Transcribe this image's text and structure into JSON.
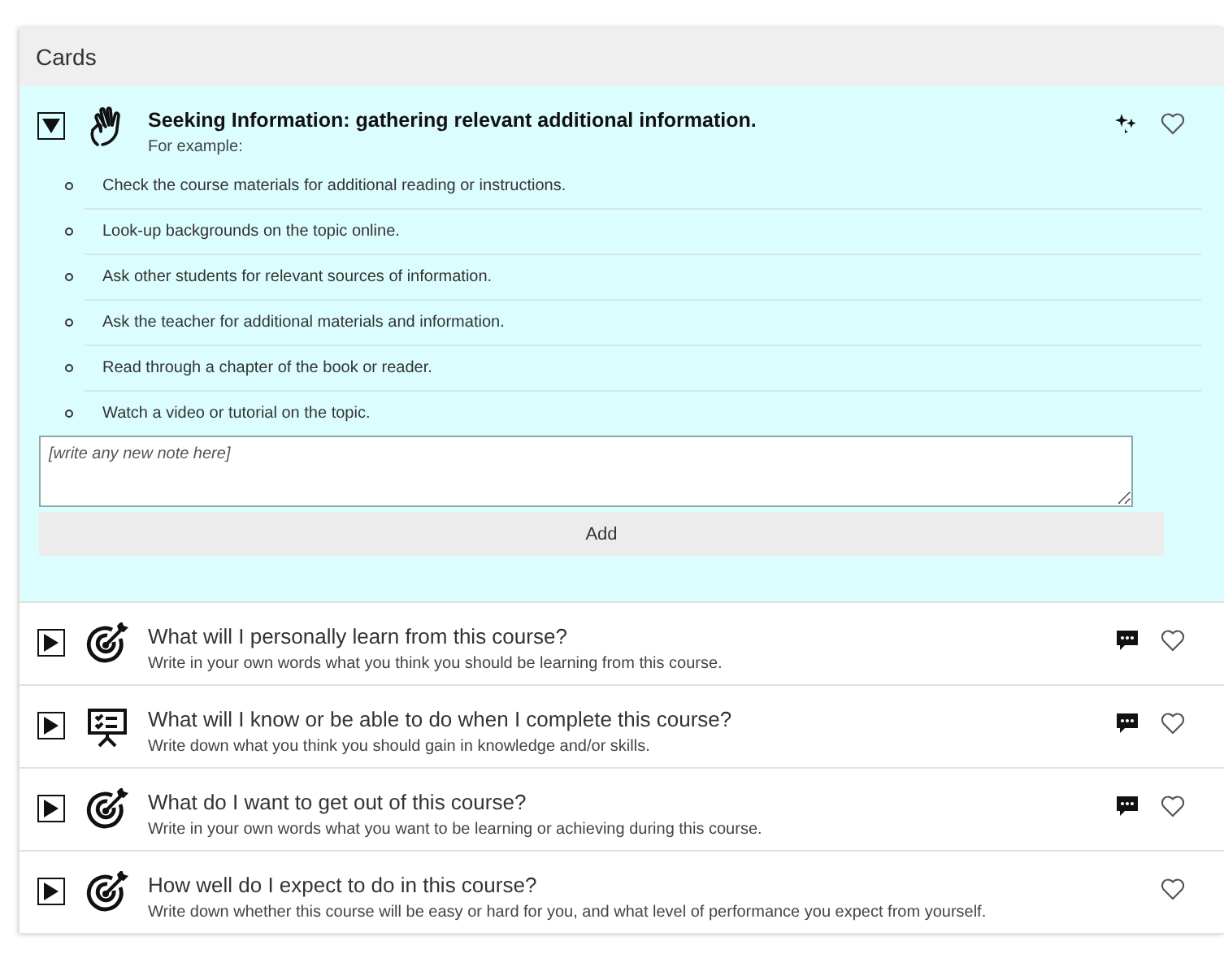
{
  "panel": {
    "title": "Cards"
  },
  "cards": [
    {
      "expanded": true,
      "icon": {
        "kind": "hand"
      },
      "badge": {
        "kind": "sparkle"
      },
      "title": "Seeking Information: gathering relevant additional information.",
      "subtitle": "For example:",
      "items": [
        "Check the course materials for additional reading or instructions.",
        "Look-up backgrounds on the topic online.",
        "Ask other students for relevant sources of information.",
        "Ask the teacher for additional materials and information.",
        "Read through a chapter of the book or reader.",
        "Watch a video or tutorial on the topic."
      ],
      "note": {
        "placeholder": "[write any new note here]"
      },
      "add_button": "Add"
    },
    {
      "expanded": false,
      "icon": {
        "kind": "target"
      },
      "badge": {
        "kind": "comment"
      },
      "title": "What will I personally learn from this course?",
      "subtitle": "Write in your own words what you think you should be learning from this course."
    },
    {
      "expanded": false,
      "icon": {
        "kind": "board"
      },
      "badge": {
        "kind": "comment"
      },
      "title": "What will I know or be able to do when I complete this course?",
      "subtitle": "Write down what you think you should gain in knowledge and/or skills."
    },
    {
      "expanded": false,
      "icon": {
        "kind": "target"
      },
      "badge": {
        "kind": "comment"
      },
      "title": "What do I want to get out of this course?",
      "subtitle": "Write in your own words what you want to be learning or achieving during this course."
    },
    {
      "expanded": false,
      "icon": {
        "kind": "target"
      },
      "title": "How well do I expect to do in this course?",
      "subtitle": "Write down whether this course will be easy or hard for you, and what level of performance you expect from yourself."
    }
  ]
}
